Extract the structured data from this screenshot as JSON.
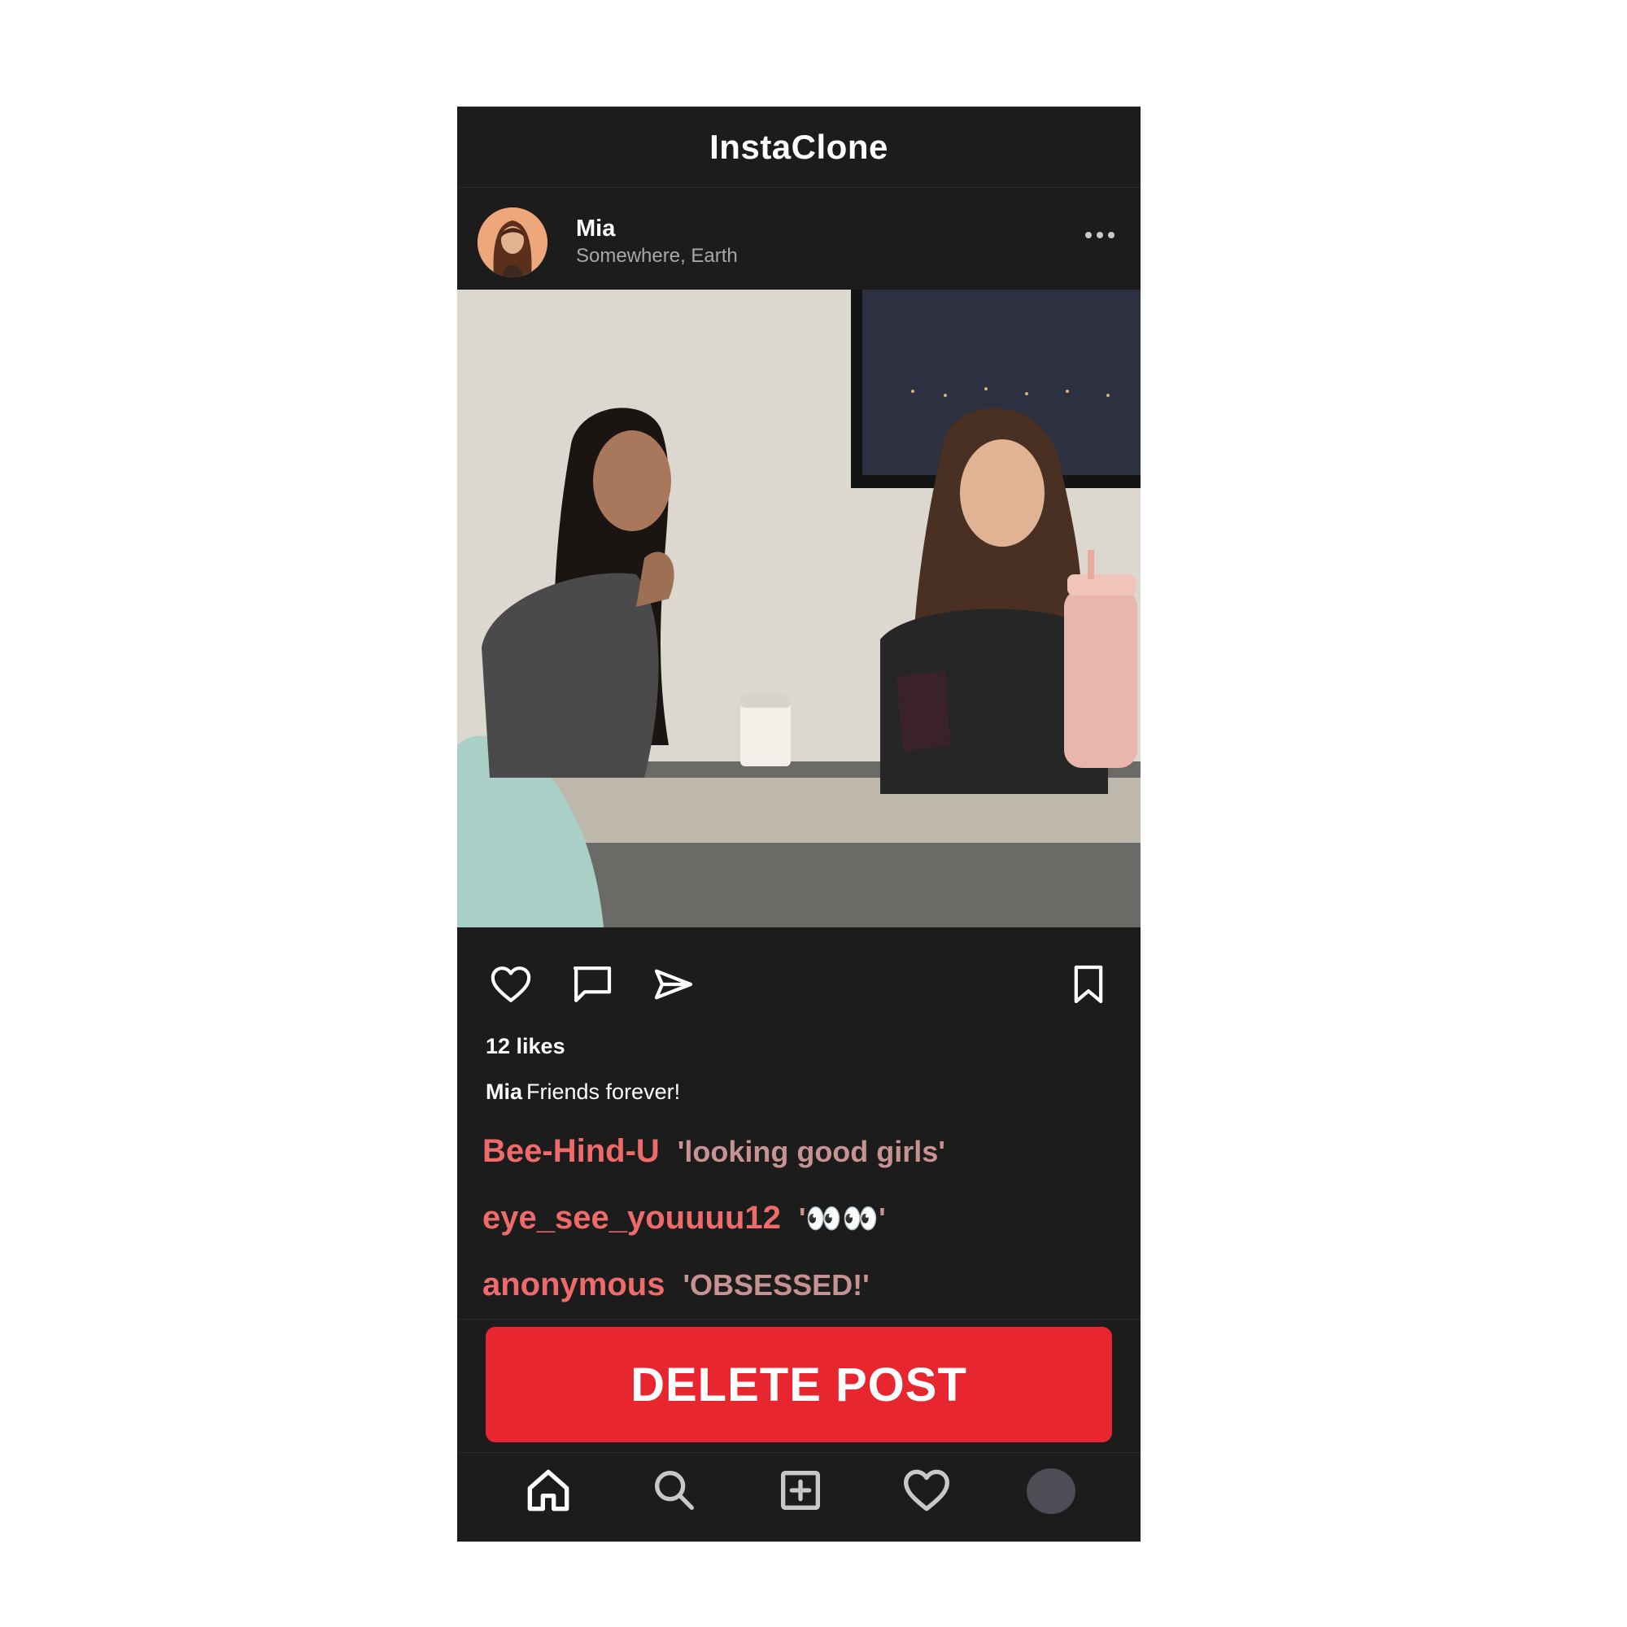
{
  "app": {
    "title": "InstaClone"
  },
  "post": {
    "user": "Mia",
    "location": "Somewhere, Earth",
    "likes": "12 likes",
    "caption_user": "Mia",
    "caption_text": "Friends forever!"
  },
  "comments": [
    {
      "user": "Bee-Hind-U",
      "text": "'looking good girls'"
    },
    {
      "user": "eye_see_youuuu12",
      "text": "'👀👀'"
    },
    {
      "user": "anonymous",
      "text": "'OBSESSED!'"
    }
  ],
  "delete_button": {
    "label": "DELETE POST"
  },
  "icons": {
    "more": "more-horizontal-icon",
    "like": "heart-icon",
    "comment": "comment-icon",
    "share": "send-icon",
    "save": "bookmark-icon",
    "home": "home-icon",
    "search": "search-icon",
    "add": "add-post-icon",
    "activity": "heart-icon",
    "profile": "profile-avatar"
  },
  "colors": {
    "background": "#1c1c1c",
    "comment_user": "#ef6b6b",
    "comment_text": "#c79292",
    "delete_button": "#e8262f"
  }
}
